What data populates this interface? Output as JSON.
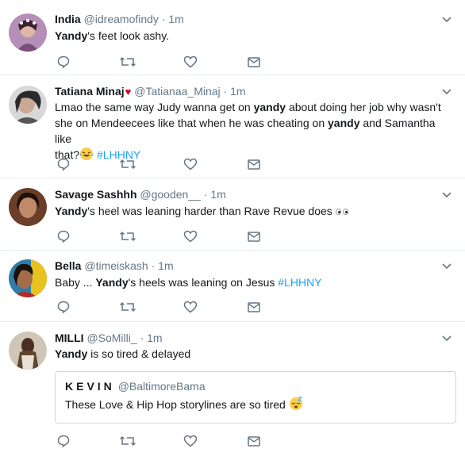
{
  "tweets": [
    {
      "name": "India",
      "handle": "@idreamofindy",
      "dot": "·",
      "time": "1m",
      "text_bold": "Yandy",
      "text_rest": "'s feet look ashy."
    },
    {
      "name": "Tatiana Minaj",
      "heart": "♥",
      "handle": "@Tatianaa_Minaj",
      "dot": "·",
      "time": "1m",
      "line1_a": "Lmao the same way Judy wanna get on ",
      "line1_bold": "yandy",
      "line1_b": " about doing her job why wasn't",
      "line2_a": "she on Mendeecees like that when he was cheating on ",
      "line2_bold": "yandy",
      "line2_b": " and Samantha like",
      "line3_a": "that?",
      "hashtag": "#LHHNY"
    },
    {
      "name": "Savage Sashhh",
      "handle": "@gooden__",
      "dot": "·",
      "time": "1m",
      "text_bold": "Yandy",
      "text_rest": "'s heel was leaning harder than Rave Revue does "
    },
    {
      "name": "Bella",
      "handle": "@timeiskash",
      "dot": "·",
      "time": "1m",
      "text_pre": "Baby ... ",
      "text_bold": "Yandy",
      "text_rest": "'s heels was leaning on Jesus ",
      "hashtag": "#LHHNY"
    },
    {
      "name": "MILLI",
      "handle": "@SoMilli_",
      "dot": "·",
      "time": "1m",
      "text_bold": "Yandy",
      "text_rest": " is so tired & delayed",
      "quote": {
        "name": "KEVIN",
        "handle": "@BaltimoreBama",
        "text": "These Love & Hip Hop storylines are so tired "
      }
    }
  ],
  "icons": {
    "reply": "reply-icon",
    "retweet": "retweet-icon",
    "like": "like-icon",
    "dm": "direct-message-icon",
    "caret": "chevron-down-icon"
  },
  "colors": {
    "link": "#1da1f2",
    "muted": "#657786",
    "border": "#e6ecf0"
  }
}
